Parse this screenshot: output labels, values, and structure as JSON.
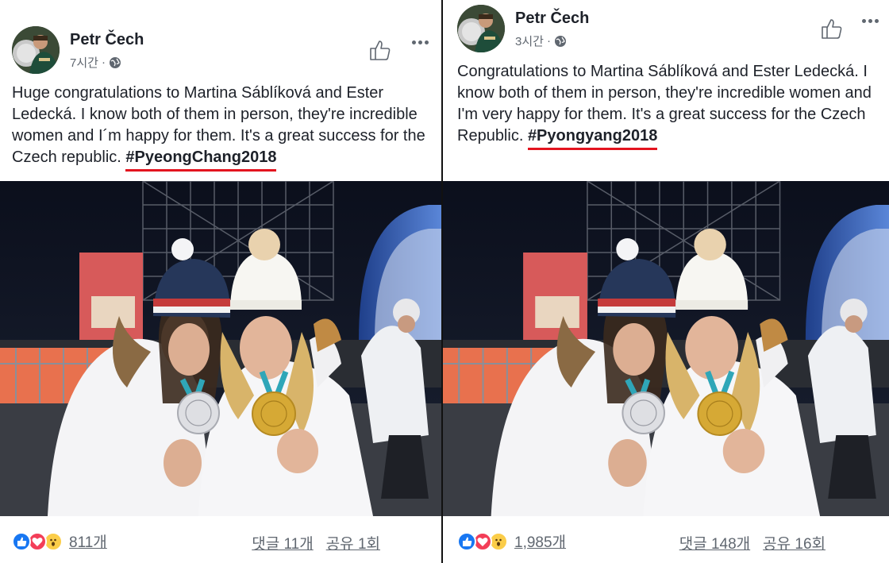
{
  "posts": [
    {
      "author": "Petr Čech",
      "time": "7시간",
      "separator": "·",
      "text": "Huge congratulations to Martina Sáblíková and Ester Ledecká. I know both of them in person, they're incredible women and I´m happy for them. It's a great success for the Czech republic. ",
      "hashtag": "#PyeongChang2018",
      "reaction_count": "811개",
      "comments": "댓글 11개",
      "shares": "공유 1회"
    },
    {
      "author": "Petr Čech",
      "time": "3시간",
      "separator": "·",
      "text": "Congratulations to Martina Sáblíková and Ester Ledecká. I know both of them in person, they're incredible women and I'm very happy for them. It's a great success for the Czech Republic. ",
      "hashtag": "#Pyongyang2018",
      "reaction_count": "1,985개",
      "comments": "댓글 148개",
      "shares": "공유 16회"
    }
  ],
  "icons": {
    "privacy": "globe-icon",
    "like": "thumbs-up-icon",
    "more": "more-dots-icon",
    "reactions": [
      "like-reaction-icon",
      "love-reaction-icon",
      "wow-reaction-icon"
    ]
  },
  "colors": {
    "hashtag_underline": "#e3141f",
    "like_blue": "#1877f2",
    "love_red": "#f33e58",
    "wow_yellow": "#fbcd49",
    "meta_gray": "#606770"
  }
}
